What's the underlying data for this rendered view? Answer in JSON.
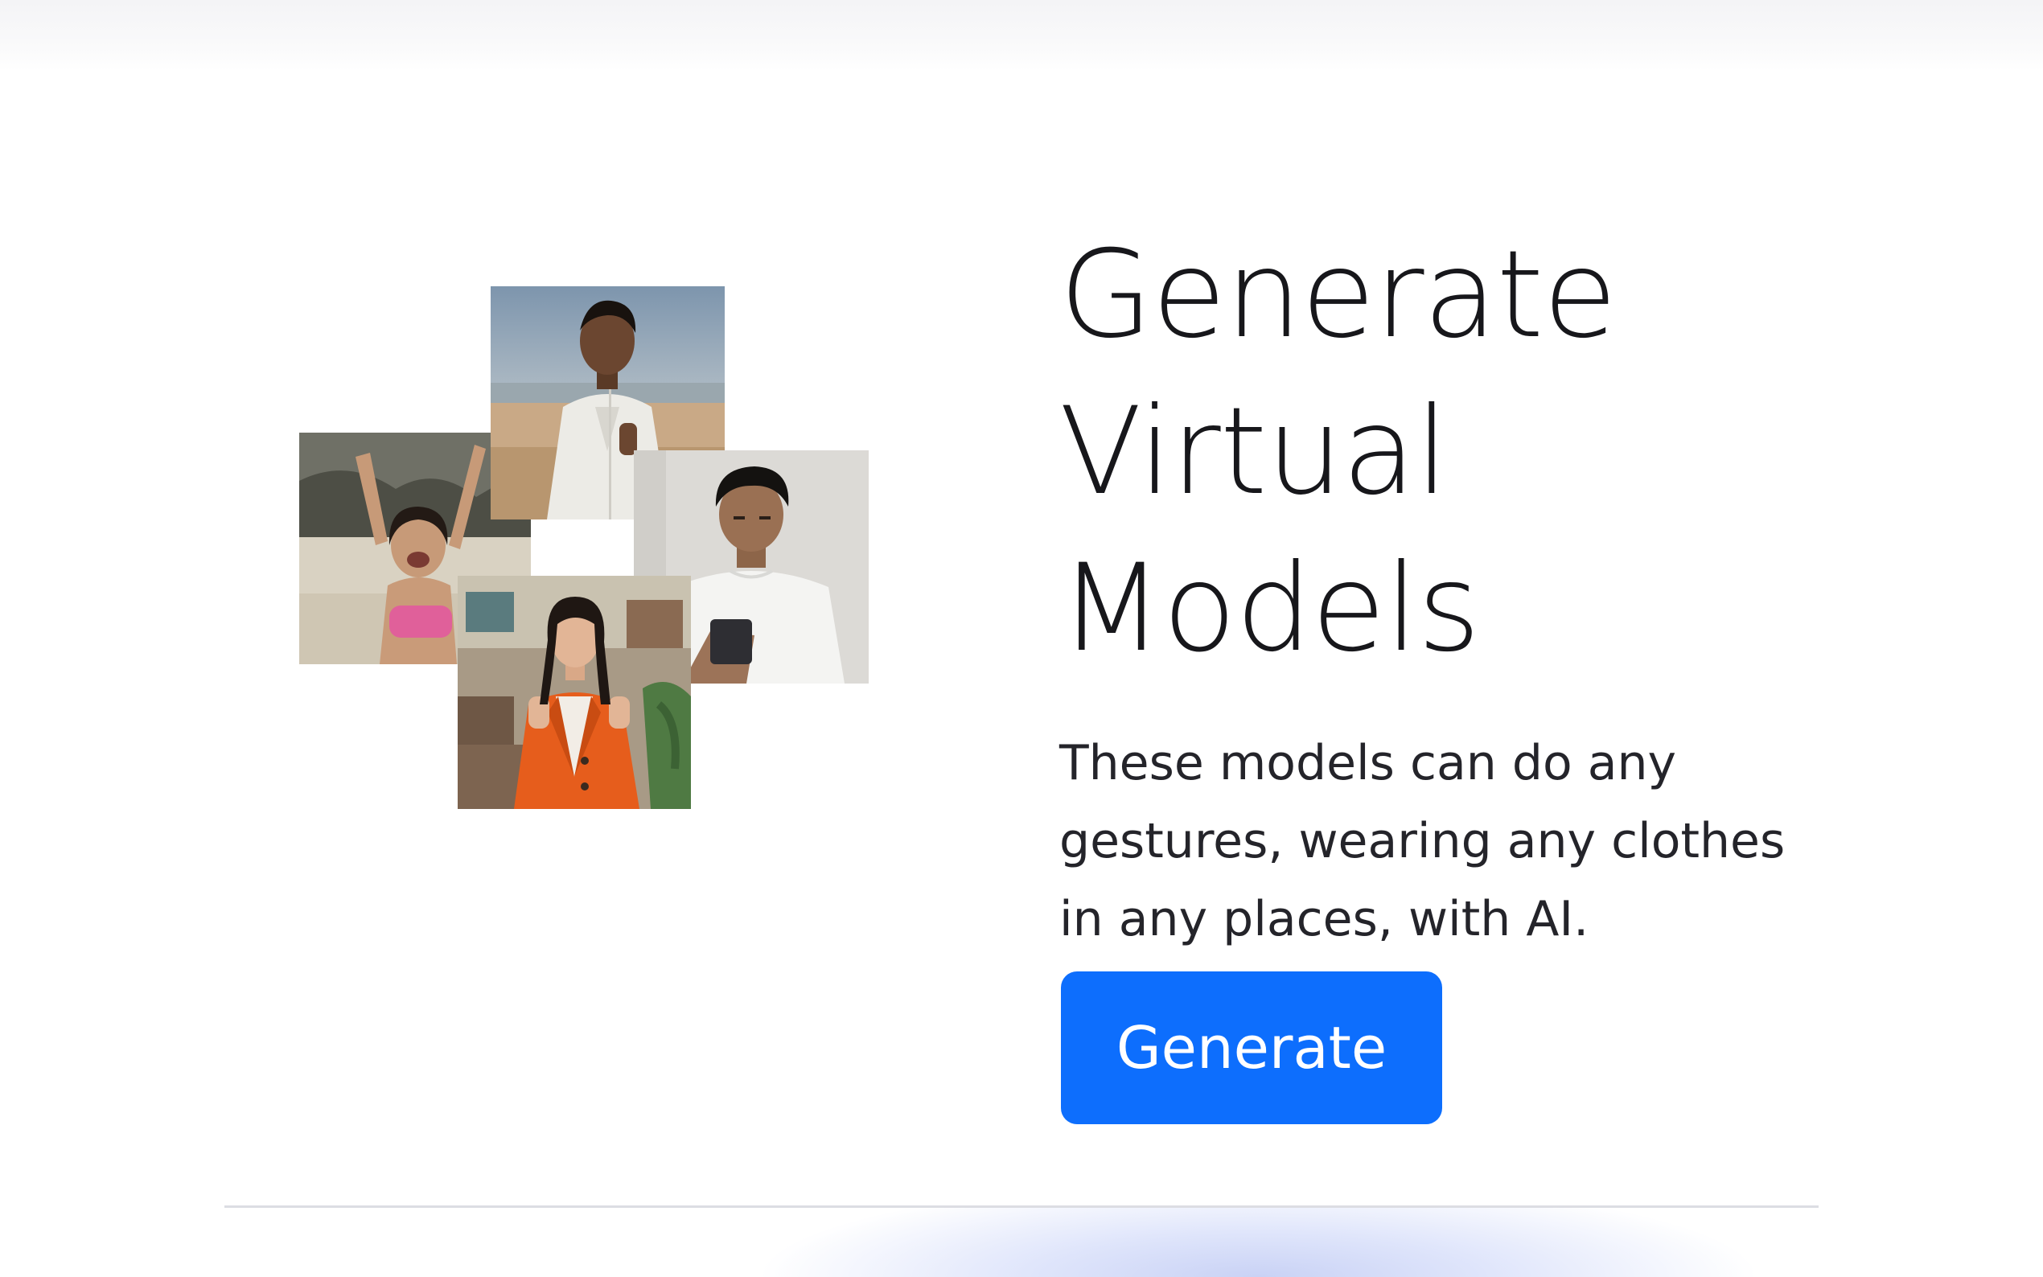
{
  "hero": {
    "title_lines": [
      "Generate",
      "Virtual",
      "Models"
    ],
    "description": "These models can do any gestures, wearing any clothes in any places, with AI.",
    "cta_label": "Generate"
  },
  "collage": {
    "photos": [
      {
        "subject": "young man in white shirt on a beach giving thumbs up"
      },
      {
        "subject": "woman cheering with raised arms on a beach"
      },
      {
        "subject": "man in white t-shirt holding a smartphone"
      },
      {
        "subject": "woman in orange blazer giving thumbs up"
      }
    ]
  },
  "colors": {
    "accent": "#0d6efd",
    "title_text": "#17171b",
    "body_text": "#24242a",
    "divider": "#dcdde3"
  }
}
